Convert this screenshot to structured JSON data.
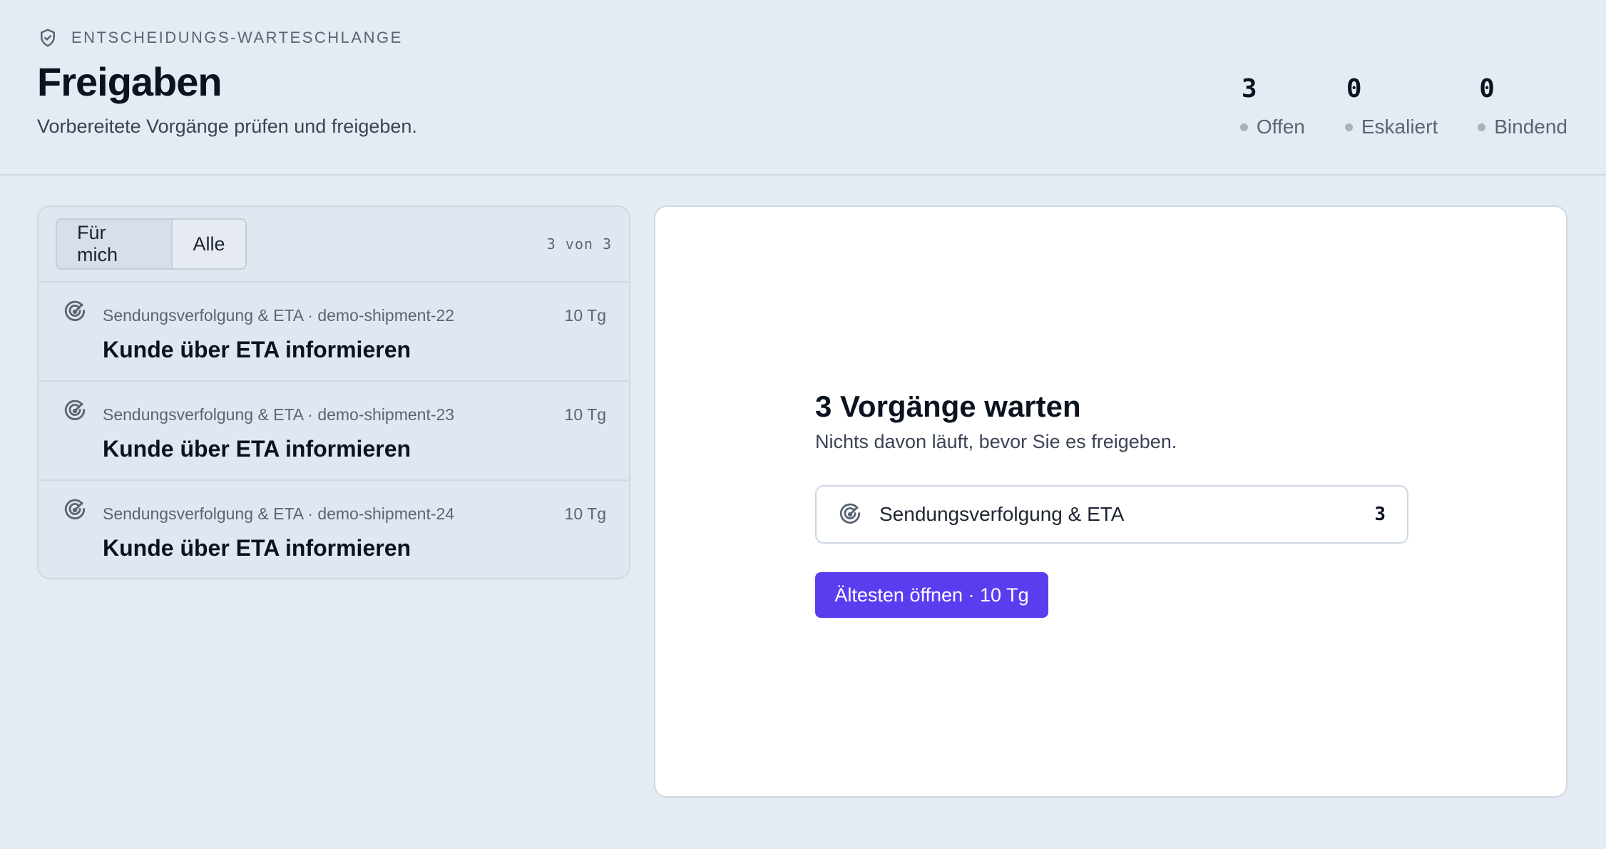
{
  "header": {
    "eyebrow_icon": "shield-check-icon",
    "eyebrow": "ENTSCHEIDUNGS-WARTESCHLANGE",
    "title": "Freigaben",
    "subtitle": "Vorbereitete Vorgänge prüfen und freigeben."
  },
  "stats": [
    {
      "value": "3",
      "label": "Offen"
    },
    {
      "value": "0",
      "label": "Eskaliert"
    },
    {
      "value": "0",
      "label": "Bindend"
    }
  ],
  "list": {
    "filters": [
      {
        "label": "Für mich",
        "active": true
      },
      {
        "label": "Alle",
        "active": false
      }
    ],
    "count": "3 von 3",
    "items": [
      {
        "icon": "radar-icon",
        "meta": "Sendungsverfolgung & ETA · demo-shipment-22",
        "age": "10 Tg",
        "title": "Kunde über ETA informieren"
      },
      {
        "icon": "radar-icon",
        "meta": "Sendungsverfolgung & ETA · demo-shipment-23",
        "age": "10 Tg",
        "title": "Kunde über ETA informieren"
      },
      {
        "icon": "radar-icon",
        "meta": "Sendungsverfolgung & ETA · demo-shipment-24",
        "age": "10 Tg",
        "title": "Kunde über ETA informieren"
      }
    ]
  },
  "detail": {
    "title": "3 Vorgänge warten",
    "subtitle": "Nichts davon läuft, bevor Sie es freigeben.",
    "group": {
      "icon": "radar-icon",
      "label": "Sendungsverfolgung & ETA",
      "count": "3"
    },
    "primary_button": "Ältesten öffnen · 10 Tg"
  },
  "colors": {
    "background": "#e5ebf3",
    "accent": "#5b3df0",
    "text": "#0b1220",
    "muted": "#5b6475"
  }
}
